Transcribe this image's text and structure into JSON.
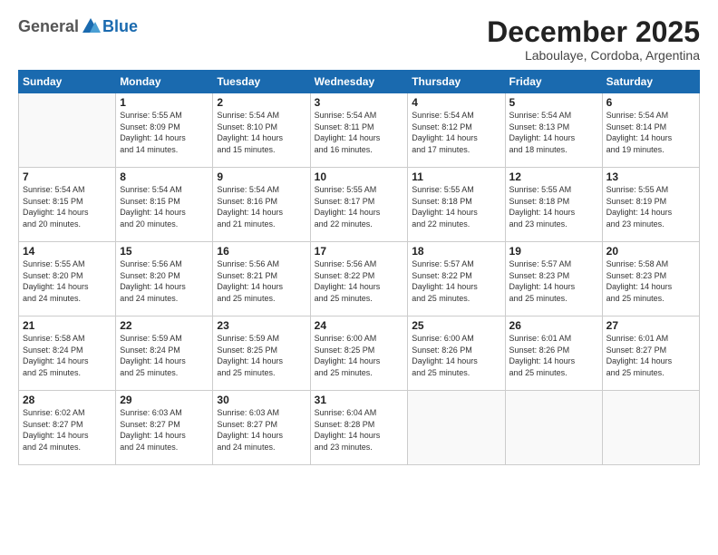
{
  "logo": {
    "general": "General",
    "blue": "Blue"
  },
  "header": {
    "month": "December 2025",
    "location": "Laboulaye, Cordoba, Argentina"
  },
  "weekdays": [
    "Sunday",
    "Monday",
    "Tuesday",
    "Wednesday",
    "Thursday",
    "Friday",
    "Saturday"
  ],
  "weeks": [
    [
      {
        "day": "",
        "info": ""
      },
      {
        "day": "1",
        "info": "Sunrise: 5:55 AM\nSunset: 8:09 PM\nDaylight: 14 hours\nand 14 minutes."
      },
      {
        "day": "2",
        "info": "Sunrise: 5:54 AM\nSunset: 8:10 PM\nDaylight: 14 hours\nand 15 minutes."
      },
      {
        "day": "3",
        "info": "Sunrise: 5:54 AM\nSunset: 8:11 PM\nDaylight: 14 hours\nand 16 minutes."
      },
      {
        "day": "4",
        "info": "Sunrise: 5:54 AM\nSunset: 8:12 PM\nDaylight: 14 hours\nand 17 minutes."
      },
      {
        "day": "5",
        "info": "Sunrise: 5:54 AM\nSunset: 8:13 PM\nDaylight: 14 hours\nand 18 minutes."
      },
      {
        "day": "6",
        "info": "Sunrise: 5:54 AM\nSunset: 8:14 PM\nDaylight: 14 hours\nand 19 minutes."
      }
    ],
    [
      {
        "day": "7",
        "info": "Sunrise: 5:54 AM\nSunset: 8:15 PM\nDaylight: 14 hours\nand 20 minutes."
      },
      {
        "day": "8",
        "info": "Sunrise: 5:54 AM\nSunset: 8:15 PM\nDaylight: 14 hours\nand 20 minutes."
      },
      {
        "day": "9",
        "info": "Sunrise: 5:54 AM\nSunset: 8:16 PM\nDaylight: 14 hours\nand 21 minutes."
      },
      {
        "day": "10",
        "info": "Sunrise: 5:55 AM\nSunset: 8:17 PM\nDaylight: 14 hours\nand 22 minutes."
      },
      {
        "day": "11",
        "info": "Sunrise: 5:55 AM\nSunset: 8:18 PM\nDaylight: 14 hours\nand 22 minutes."
      },
      {
        "day": "12",
        "info": "Sunrise: 5:55 AM\nSunset: 8:18 PM\nDaylight: 14 hours\nand 23 minutes."
      },
      {
        "day": "13",
        "info": "Sunrise: 5:55 AM\nSunset: 8:19 PM\nDaylight: 14 hours\nand 23 minutes."
      }
    ],
    [
      {
        "day": "14",
        "info": "Sunrise: 5:55 AM\nSunset: 8:20 PM\nDaylight: 14 hours\nand 24 minutes."
      },
      {
        "day": "15",
        "info": "Sunrise: 5:56 AM\nSunset: 8:20 PM\nDaylight: 14 hours\nand 24 minutes."
      },
      {
        "day": "16",
        "info": "Sunrise: 5:56 AM\nSunset: 8:21 PM\nDaylight: 14 hours\nand 25 minutes."
      },
      {
        "day": "17",
        "info": "Sunrise: 5:56 AM\nSunset: 8:22 PM\nDaylight: 14 hours\nand 25 minutes."
      },
      {
        "day": "18",
        "info": "Sunrise: 5:57 AM\nSunset: 8:22 PM\nDaylight: 14 hours\nand 25 minutes."
      },
      {
        "day": "19",
        "info": "Sunrise: 5:57 AM\nSunset: 8:23 PM\nDaylight: 14 hours\nand 25 minutes."
      },
      {
        "day": "20",
        "info": "Sunrise: 5:58 AM\nSunset: 8:23 PM\nDaylight: 14 hours\nand 25 minutes."
      }
    ],
    [
      {
        "day": "21",
        "info": "Sunrise: 5:58 AM\nSunset: 8:24 PM\nDaylight: 14 hours\nand 25 minutes."
      },
      {
        "day": "22",
        "info": "Sunrise: 5:59 AM\nSunset: 8:24 PM\nDaylight: 14 hours\nand 25 minutes."
      },
      {
        "day": "23",
        "info": "Sunrise: 5:59 AM\nSunset: 8:25 PM\nDaylight: 14 hours\nand 25 minutes."
      },
      {
        "day": "24",
        "info": "Sunrise: 6:00 AM\nSunset: 8:25 PM\nDaylight: 14 hours\nand 25 minutes."
      },
      {
        "day": "25",
        "info": "Sunrise: 6:00 AM\nSunset: 8:26 PM\nDaylight: 14 hours\nand 25 minutes."
      },
      {
        "day": "26",
        "info": "Sunrise: 6:01 AM\nSunset: 8:26 PM\nDaylight: 14 hours\nand 25 minutes."
      },
      {
        "day": "27",
        "info": "Sunrise: 6:01 AM\nSunset: 8:27 PM\nDaylight: 14 hours\nand 25 minutes."
      }
    ],
    [
      {
        "day": "28",
        "info": "Sunrise: 6:02 AM\nSunset: 8:27 PM\nDaylight: 14 hours\nand 24 minutes."
      },
      {
        "day": "29",
        "info": "Sunrise: 6:03 AM\nSunset: 8:27 PM\nDaylight: 14 hours\nand 24 minutes."
      },
      {
        "day": "30",
        "info": "Sunrise: 6:03 AM\nSunset: 8:27 PM\nDaylight: 14 hours\nand 24 minutes."
      },
      {
        "day": "31",
        "info": "Sunrise: 6:04 AM\nSunset: 8:28 PM\nDaylight: 14 hours\nand 23 minutes."
      },
      {
        "day": "",
        "info": ""
      },
      {
        "day": "",
        "info": ""
      },
      {
        "day": "",
        "info": ""
      }
    ]
  ]
}
